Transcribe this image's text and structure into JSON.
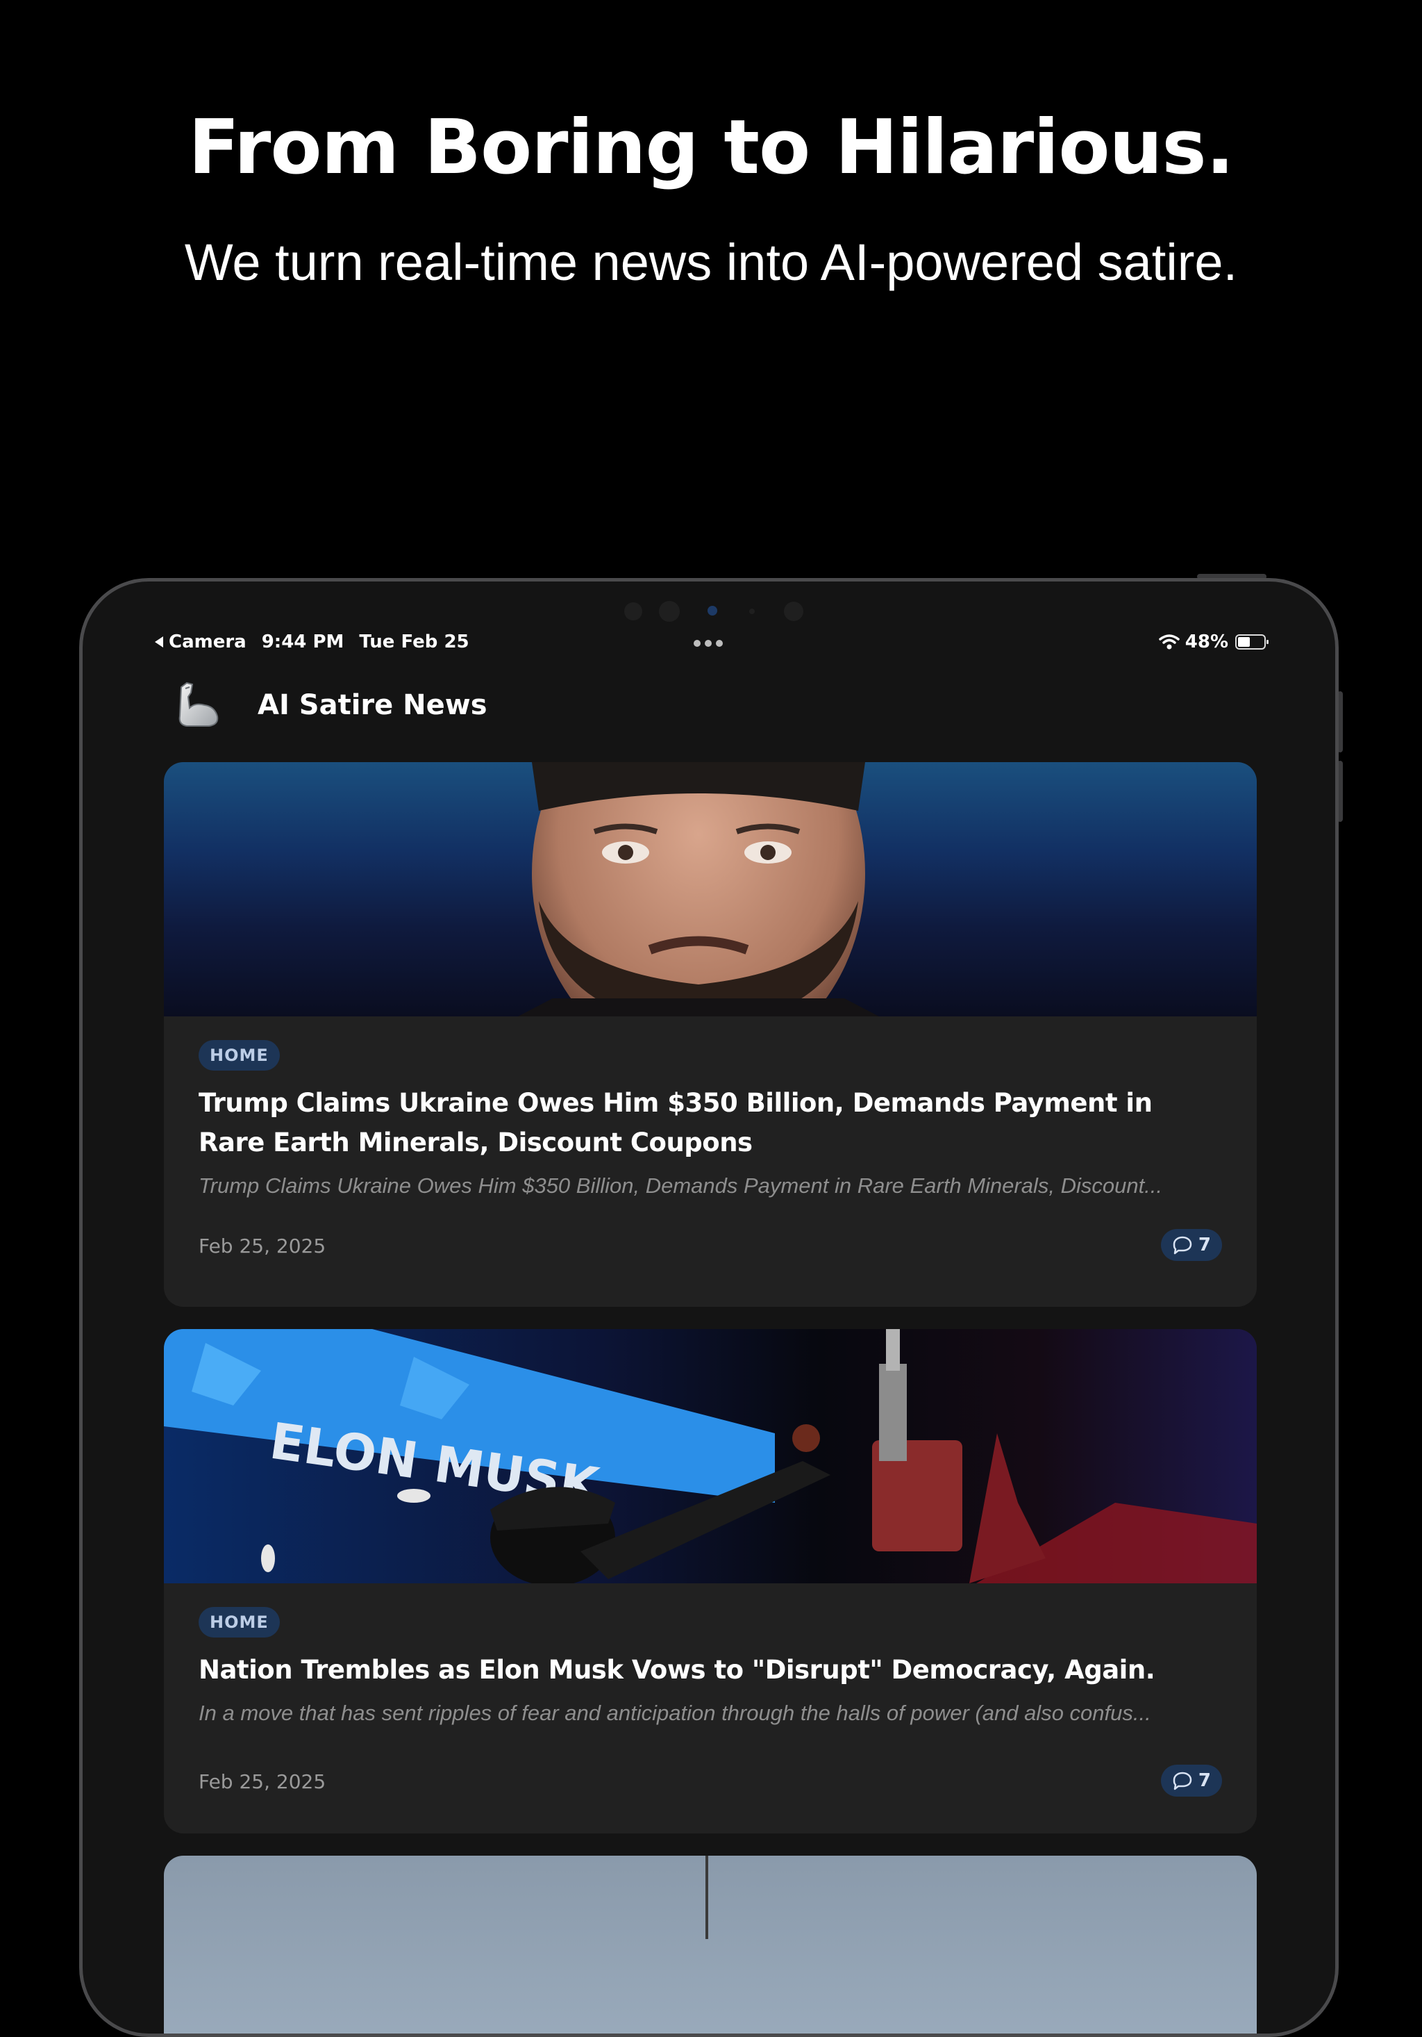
{
  "marketing": {
    "headline": "From Boring to Hilarious.",
    "subheadline": "We turn real-time news into AI-powered satire."
  },
  "status_bar": {
    "back_label": "Camera",
    "time": "9:44 PM",
    "date": "Tue Feb 25",
    "battery": "48%",
    "battery_level": 0.48
  },
  "app": {
    "title": "AI Satire News",
    "logo_icon": "flexed-bicep-icon"
  },
  "articles": [
    {
      "category": "HOME",
      "title": "Trump Claims Ukraine Owes Him $350 Billion, Demands Payment in Rare Earth Minerals, Discount Coupons",
      "excerpt": "Trump Claims Ukraine Owes Him $350 Billion, Demands Payment in Rare Earth Minerals, Discount...",
      "date": "Feb 25, 2025",
      "comments": "7"
    },
    {
      "category": "HOME",
      "title": "Nation Trembles as Elon Musk Vows to \"Disrupt\" Democracy, Again.",
      "excerpt": "In a move that has sent ripples of fear and anticipation through the halls of power (and also confus...",
      "date": "Feb 25, 2025",
      "comments": "7",
      "image_text": "ELON MUSK"
    }
  ],
  "colors": {
    "background": "#000000",
    "device_screen": "#141414",
    "card": "#212121",
    "badge_bg": "#1d3556",
    "badge_text": "#bccde6"
  }
}
